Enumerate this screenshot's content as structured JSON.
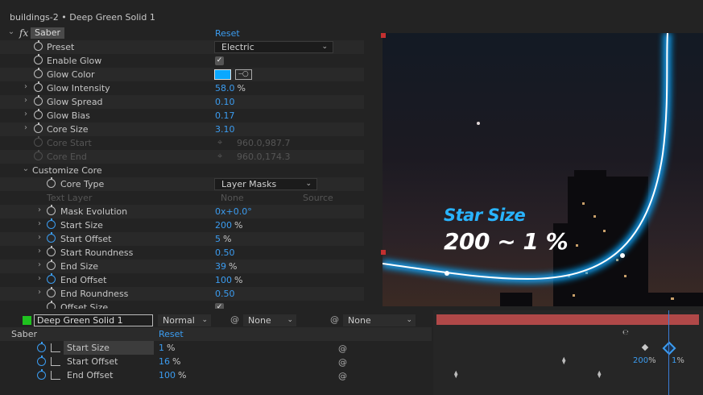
{
  "window": {
    "title": "buildings-2 • Deep Green Solid 1"
  },
  "effect": {
    "name": "Saber",
    "fx_label": "fx",
    "reset_label": "Reset"
  },
  "props": {
    "preset": {
      "label": "Preset",
      "value": "Electric"
    },
    "enable_glow": {
      "label": "Enable Glow",
      "checked": true
    },
    "glow_color": {
      "label": "Glow Color",
      "color": "#0aa8ff"
    },
    "glow_intensity": {
      "label": "Glow Intensity",
      "value": "58.0",
      "unit": "%"
    },
    "glow_spread": {
      "label": "Glow Spread",
      "value": "0.10"
    },
    "glow_bias": {
      "label": "Glow Bias",
      "value": "0.17"
    },
    "core_size": {
      "label": "Core Size",
      "value": "3.10"
    },
    "core_start": {
      "label": "Core Start",
      "value": "960.0,987.7"
    },
    "core_end": {
      "label": "Core End",
      "value": "960.0,174.3"
    },
    "customize_core": {
      "label": "Customize Core"
    },
    "core_type": {
      "label": "Core Type",
      "value": "Layer Masks"
    },
    "text_layer": {
      "label": "Text Layer",
      "value": "None",
      "source": "Source"
    },
    "mask_evolution": {
      "label": "Mask Evolution",
      "value": "0x+0.0°"
    },
    "start_size": {
      "label": "Start Size",
      "value": "200",
      "unit": "%"
    },
    "start_offset": {
      "label": "Start Offset",
      "value": "5",
      "unit": "%"
    },
    "start_roundness": {
      "label": "Start Roundness",
      "value": "0.50"
    },
    "end_size": {
      "label": "End Size",
      "value": "39",
      "unit": "%"
    },
    "end_offset": {
      "label": "End Offset",
      "value": "100",
      "unit": "%"
    },
    "end_roundness": {
      "label": "End Roundness",
      "value": "0.50"
    },
    "offset_size": {
      "label": "Offset Size"
    }
  },
  "overlay": {
    "title": "Star Size",
    "value": "200 ~ 1 %"
  },
  "timeline": {
    "layer_name": "Deep Green Solid 1",
    "mode": "Normal",
    "track_matte": "None",
    "parent": "None",
    "effect_name": "Saber",
    "reset_label": "Reset",
    "rows": [
      {
        "label": "Start Size",
        "value": "1",
        "unit": "%"
      },
      {
        "label": "Start Offset",
        "value": "16",
        "unit": "%"
      },
      {
        "label": "End Offset",
        "value": "100",
        "unit": "%"
      }
    ],
    "kf_labels": {
      "left": "200",
      "left_unit": "%",
      "right": "1",
      "right_unit": "%"
    }
  },
  "colors": {
    "accent": "#3b9cf0",
    "layer_label": "#1fc21f",
    "work_area": "#b04848",
    "glow": "#0aa8ff"
  }
}
